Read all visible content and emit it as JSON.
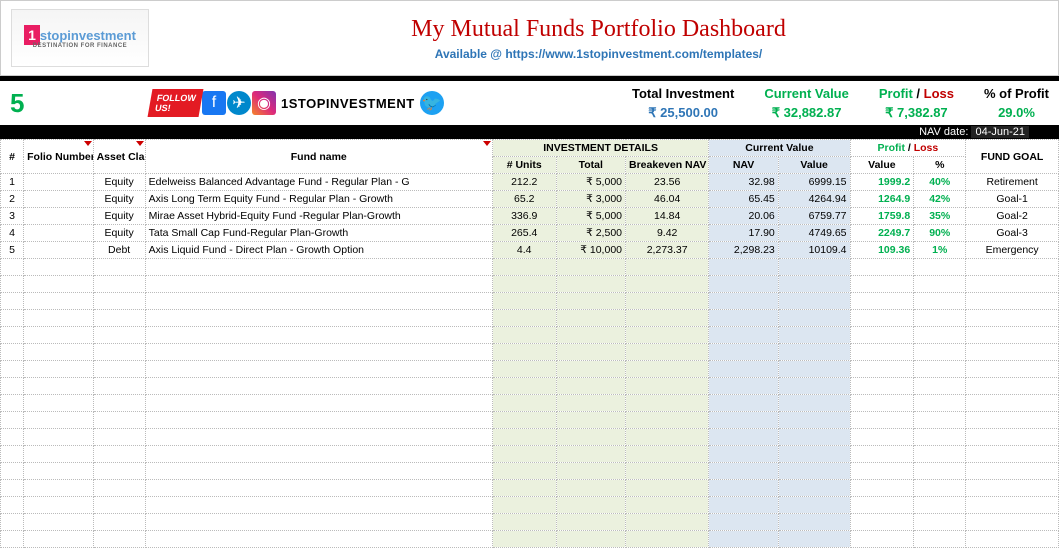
{
  "header": {
    "logo_brand": "stopinvestment",
    "logo_tagline": "DESTINATION FOR FINANCE",
    "title": "My Mutual Funds Portfolio Dashboard",
    "subtitle": "Available @ https://www.1stopinvestment.com/templates/"
  },
  "summary": {
    "count": "5",
    "brand_text": "1STOPINVESTMENT",
    "total_investment_label": "Total Investment",
    "total_investment": "₹ 25,500.00",
    "current_value_label": "Current Value",
    "current_value": "₹ 32,882.87",
    "profit_label": "Profit",
    "loss_label": "Loss",
    "profit_value": "₹ 7,382.87",
    "pct_label": "% of Profit",
    "pct_value": "29.0%"
  },
  "nav_date": {
    "label": "NAV date:",
    "value": "04-Jun-21"
  },
  "headers": {
    "row": "#",
    "folio": "Folio Number",
    "asset": "Asset Class",
    "fund": "Fund name",
    "inv_group": "INVESTMENT DETAILS",
    "units": "# Units",
    "total": "Total",
    "bnav": "Breakeven NAV",
    "cur_group": "Current Value",
    "nav": "NAV",
    "value": "Value",
    "pl_group_p": "Profit",
    "pl_group_l": "Loss",
    "plv": "Value",
    "plp": "%",
    "goal": "FUND GOAL"
  },
  "rows": [
    {
      "n": "1",
      "folio": "",
      "asset": "Equity",
      "fund": "Edelweiss Balanced Advantage Fund - Regular Plan - G",
      "units": "212.2",
      "total": "₹ 5,000",
      "bnav": "23.56",
      "nav": "32.98",
      "value": "6999.15",
      "plv": "1999.2",
      "plp": "40%",
      "goal": "Retirement"
    },
    {
      "n": "2",
      "folio": "",
      "asset": "Equity",
      "fund": "Axis Long Term Equity Fund - Regular Plan - Growth",
      "units": "65.2",
      "total": "₹ 3,000",
      "bnav": "46.04",
      "nav": "65.45",
      "value": "4264.94",
      "plv": "1264.9",
      "plp": "42%",
      "goal": "Goal-1"
    },
    {
      "n": "3",
      "folio": "",
      "asset": "Equity",
      "fund": "Mirae Asset Hybrid-Equity Fund -Regular Plan-Growth",
      "units": "336.9",
      "total": "₹ 5,000",
      "bnav": "14.84",
      "nav": "20.06",
      "value": "6759.77",
      "plv": "1759.8",
      "plp": "35%",
      "goal": "Goal-2"
    },
    {
      "n": "4",
      "folio": "",
      "asset": "Equity",
      "fund": "Tata Small Cap Fund-Regular Plan-Growth",
      "units": "265.4",
      "total": "₹ 2,500",
      "bnav": "9.42",
      "nav": "17.90",
      "value": "4749.65",
      "plv": "2249.7",
      "plp": "90%",
      "goal": "Goal-3"
    },
    {
      "n": "5",
      "folio": "",
      "asset": "Debt",
      "fund": "Axis Liquid Fund - Direct Plan - Growth Option",
      "units": "4.4",
      "total": "₹ 10,000",
      "bnav": "2,273.37",
      "nav": "2,298.23",
      "value": "10109.4",
      "plv": "109.36",
      "plp": "1%",
      "goal": "Emergency"
    }
  ],
  "empty_row_count": 17
}
